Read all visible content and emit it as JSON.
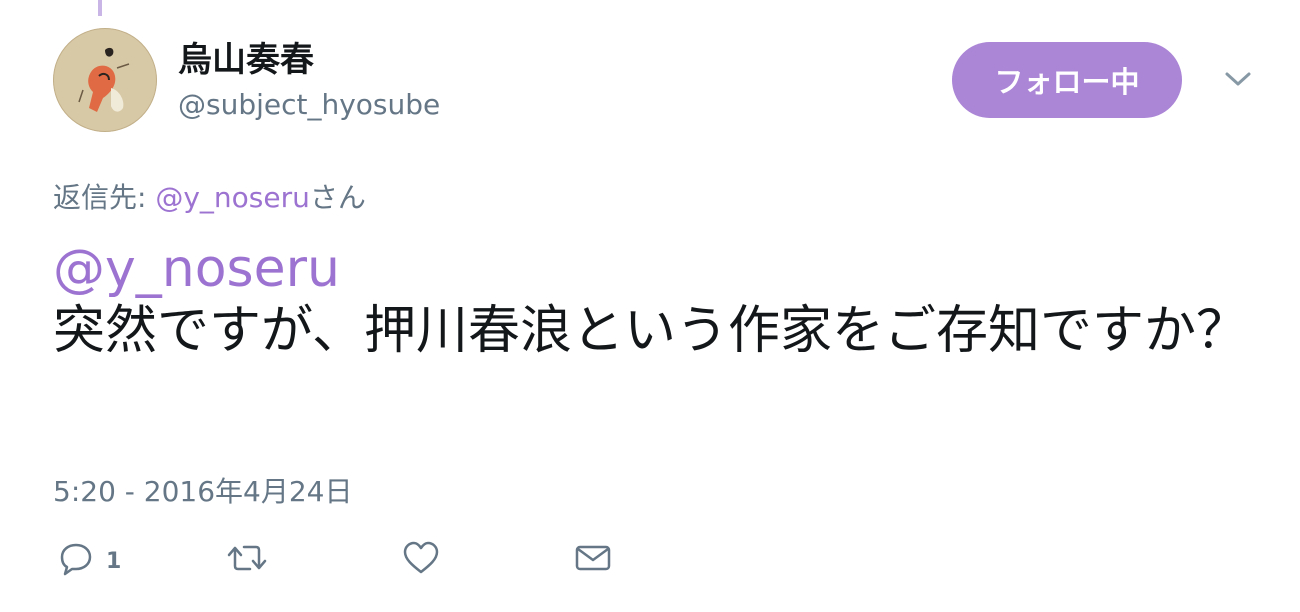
{
  "user": {
    "display_name": "烏山奏春",
    "handle": "@subject_hyosube"
  },
  "follow_button_label": "フォロー中",
  "reply_to": {
    "prefix": "返信先: ",
    "username": "@y_noseru",
    "suffix": "さん"
  },
  "tweet": {
    "mention": "@y_noseru",
    "text": "突然ですが、押川春浪という作家をご存知ですか？",
    "timestamp": "5:20 - 2016年4月24日"
  },
  "actions": {
    "reply_count": "1",
    "reply_icon": "reply-icon",
    "retweet_icon": "retweet-icon",
    "like_icon": "heart-icon",
    "dm_icon": "envelope-icon"
  },
  "colors": {
    "accent": "#ab85d6",
    "link": "#9d73d1",
    "secondary_text": "#657786",
    "primary_text": "#14171a"
  }
}
